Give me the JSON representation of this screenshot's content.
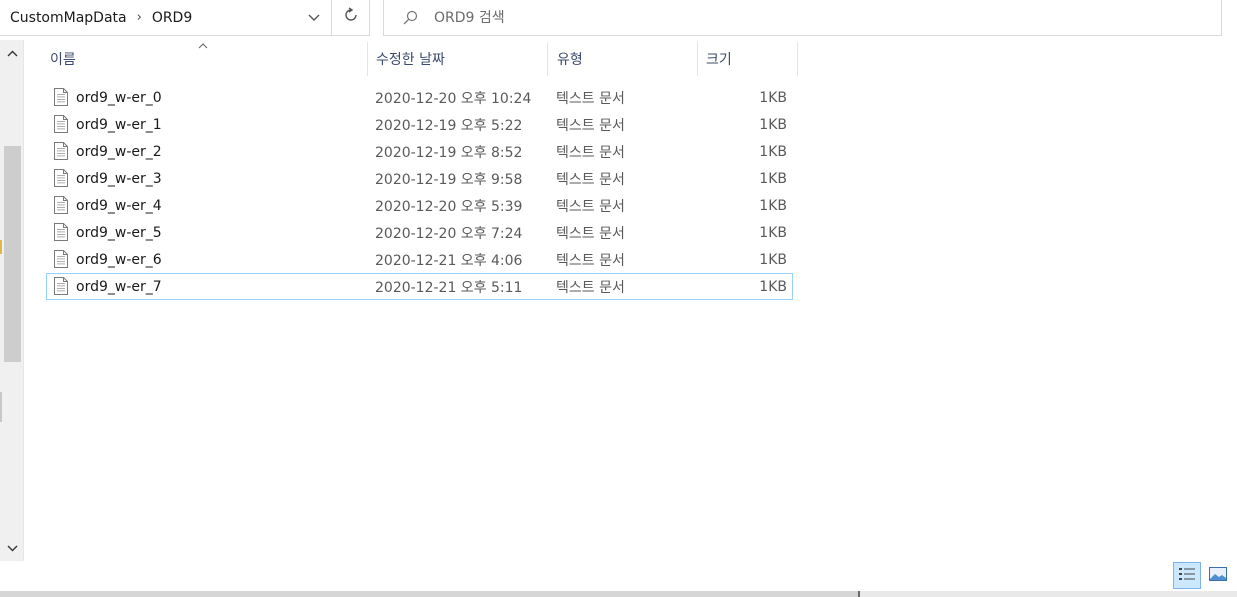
{
  "address": {
    "crumbs": [
      "CustomMapData",
      "ORD9"
    ],
    "separator": "›"
  },
  "search": {
    "placeholder": "ORD9 검색"
  },
  "columns": {
    "name": "이름",
    "date": "수정한 날짜",
    "type": "유형",
    "size": "크기"
  },
  "files": [
    {
      "name": "ord9_w-er_0",
      "date": "2020-12-20 오후 10:24",
      "type": "텍스트 문서",
      "size": "1KB"
    },
    {
      "name": "ord9_w-er_1",
      "date": "2020-12-19 오후 5:22",
      "type": "텍스트 문서",
      "size": "1KB"
    },
    {
      "name": "ord9_w-er_2",
      "date": "2020-12-19 오후 8:52",
      "type": "텍스트 문서",
      "size": "1KB"
    },
    {
      "name": "ord9_w-er_3",
      "date": "2020-12-19 오후 9:58",
      "type": "텍스트 문서",
      "size": "1KB"
    },
    {
      "name": "ord9_w-er_4",
      "date": "2020-12-20 오후 5:39",
      "type": "텍스트 문서",
      "size": "1KB"
    },
    {
      "name": "ord9_w-er_5",
      "date": "2020-12-20 오후 7:24",
      "type": "텍스트 문서",
      "size": "1KB"
    },
    {
      "name": "ord9_w-er_6",
      "date": "2020-12-21 오후 4:06",
      "type": "텍스트 문서",
      "size": "1KB"
    },
    {
      "name": "ord9_w-er_7",
      "date": "2020-12-21 오후 5:11",
      "type": "텍스트 문서",
      "size": "1KB"
    }
  ],
  "selected_index": 7,
  "icons": {
    "dropdown": "chevron-down-icon",
    "refresh": "refresh-icon",
    "search": "search-icon",
    "file": "text-document-icon",
    "scroll_up": "chevron-up-icon",
    "scroll_down": "chevron-down-icon",
    "view_details": "details-view-icon",
    "view_tiles": "large-icons-view-icon",
    "sort": "sort-caret-icon"
  },
  "colors": {
    "selection_border": "#99d1ff",
    "view_active_bg": "#cce8ff",
    "header_text": "#3c4b6a"
  }
}
